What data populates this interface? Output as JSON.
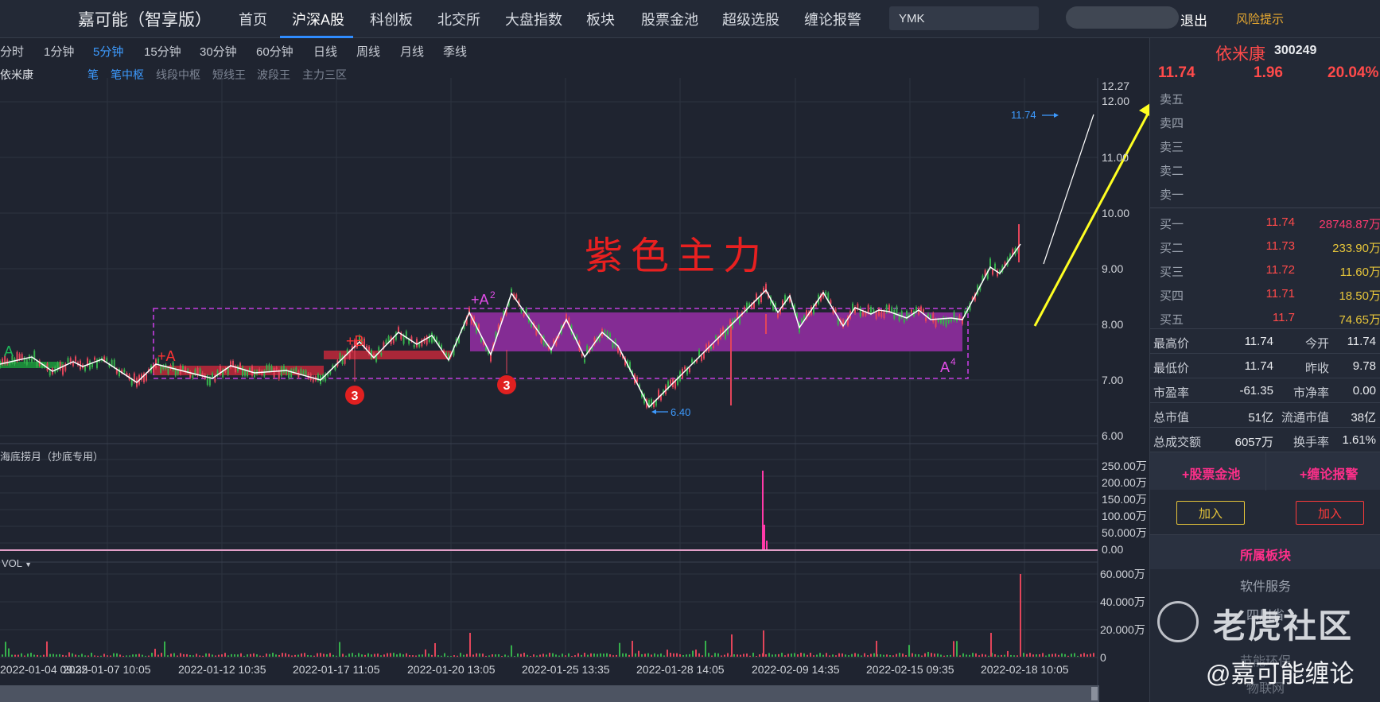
{
  "app": {
    "brand": "嘉可能（智享版）",
    "logout": "退出",
    "risk": "风险提示",
    "search_value": "YMK"
  },
  "nav": [
    {
      "label": "首页",
      "active": false
    },
    {
      "label": "沪深A股",
      "active": true
    },
    {
      "label": "科创板",
      "active": false
    },
    {
      "label": "北交所",
      "active": false
    },
    {
      "label": "大盘指数",
      "active": false
    },
    {
      "label": "板块",
      "active": false
    },
    {
      "label": "股票金池",
      "active": false
    },
    {
      "label": "超级选股",
      "active": false
    },
    {
      "label": "缠论报警",
      "active": false
    }
  ],
  "periods": [
    "分时",
    "1分钟",
    "5分钟",
    "15分钟",
    "30分钟",
    "60分钟",
    "日线",
    "周线",
    "月线",
    "季线"
  ],
  "active_period": "5分钟",
  "chart_tools": {
    "stock_name": "依米康",
    "tools": [
      "笔",
      "笔中枢",
      "线段中枢",
      "短线王",
      "波段王",
      "主力三区"
    ],
    "active_tools": [
      "笔",
      "笔中枢"
    ]
  },
  "main_chart": {
    "y_ticks": [
      "12.27",
      "12.00",
      "11.00",
      "10.00",
      "9.00",
      "8.00",
      "7.00",
      "6.00"
    ],
    "x_ticks": [
      "2022-01-04 09:35",
      "2022-01-07 10:05",
      "2022-01-12 10:35",
      "2022-01-17 11:05",
      "2022-01-20 13:05",
      "2022-01-25 13:35",
      "2022-01-28 14:05",
      "2022-02-09 14:35",
      "2022-02-15 09:35",
      "2022-02-18 10:05"
    ],
    "annotation_title": "紫色主力",
    "price_label_high": "11.74",
    "price_label_low": "6.40",
    "labels": {
      "a": "A",
      "plus_a": "+A",
      "plus_b": "+B",
      "plus_a2": "+A",
      "a2_sup": "2",
      "a4": "A",
      "a4_sup": "4",
      "three": "3"
    },
    "colors": {
      "purple_box": "#b13ad6",
      "red_zone": "#b8283a",
      "green_zone": "#1c8a3a",
      "bi_line": "#ffffff",
      "arrow": "#ffff22",
      "annotation": "#e82020"
    }
  },
  "indicator_panel": {
    "title": "海底捞月（抄底专用）",
    "y_ticks": [
      "250.00万",
      "200.00万",
      "150.00万",
      "100.00万",
      "50.000万",
      "0.00"
    ]
  },
  "volume_panel": {
    "title": "VOL",
    "y_ticks": [
      "60.000万",
      "40.000万",
      "20.000万",
      "0"
    ]
  },
  "quote": {
    "name": "依米康",
    "code": "300249",
    "price": "11.74",
    "change": "1.96",
    "pct": "20.04%",
    "asks": [
      {
        "label": "卖五"
      },
      {
        "label": "卖四"
      },
      {
        "label": "卖三"
      },
      {
        "label": "卖二"
      },
      {
        "label": "卖一"
      }
    ],
    "bids": [
      {
        "label": "买一",
        "price": "11.74",
        "vol": "28748.87万"
      },
      {
        "label": "买二",
        "price": "11.73",
        "vol": "233.90万"
      },
      {
        "label": "买三",
        "price": "11.72",
        "vol": "11.60万"
      },
      {
        "label": "买四",
        "price": "11.71",
        "vol": "18.50万"
      },
      {
        "label": "买五",
        "price": "11.7",
        "vol": "74.65万"
      }
    ],
    "stats": [
      {
        "k1": "最高价",
        "v1": "11.74",
        "k2": "今开",
        "v2": "11.74"
      },
      {
        "k1": "最低价",
        "v1": "11.74",
        "k2": "昨收",
        "v2": "9.78"
      },
      {
        "k1": "市盈率",
        "v1": "-61.35",
        "k2": "市净率",
        "v2": "0.00"
      },
      {
        "k1": "总市值",
        "v1": "51亿",
        "k2": "流通市值",
        "v2": "38亿"
      },
      {
        "k1": "总成交额",
        "v1": "6057万",
        "k2": "换手率",
        "v2": "1.61%"
      }
    ],
    "actions": {
      "pool": "+股票金池",
      "alert": "+缠论报警",
      "add": "加入"
    },
    "sector_header": "所属板块",
    "sectors": [
      "软件服务",
      "四川省",
      "节能环保",
      "物联网"
    ]
  },
  "watermark": {
    "brand": "老虎社区",
    "author": "@嘉可能缠论"
  }
}
